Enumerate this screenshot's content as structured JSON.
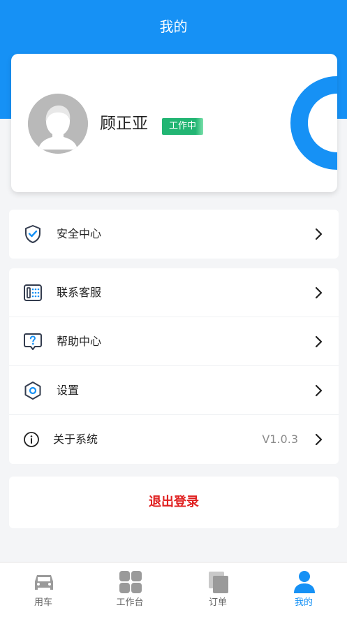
{
  "header": {
    "title": "我的"
  },
  "profile": {
    "name": "顾正亚",
    "status": "工作中",
    "avatar_icon": "user-avatar-icon"
  },
  "menu": {
    "security": {
      "label": "安全中心",
      "icon": "shield-check-icon"
    },
    "support": {
      "label": "联系客服",
      "icon": "phone-keypad-icon"
    },
    "help": {
      "label": "帮助中心",
      "icon": "question-bubble-icon"
    },
    "settings": {
      "label": "设置",
      "icon": "hexagon-gear-icon"
    },
    "about": {
      "label": "关于系统",
      "value": "V1.0.3",
      "icon": "info-icon"
    }
  },
  "logout": {
    "label": "退出登录"
  },
  "tabs": [
    {
      "label": "用车",
      "icon": "car-icon"
    },
    {
      "label": "工作台",
      "icon": "grid-icon"
    },
    {
      "label": "订单",
      "icon": "orders-icon"
    },
    {
      "label": "我的",
      "icon": "user-icon",
      "active": true
    }
  ],
  "colors": {
    "primary": "#1691f5",
    "status_green": "#22b573",
    "logout_red": "#e02020"
  }
}
